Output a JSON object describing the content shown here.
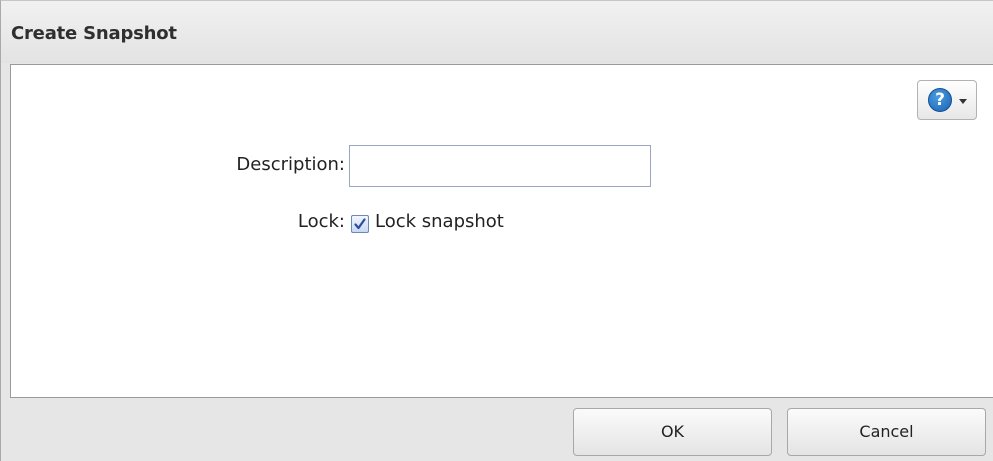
{
  "dialog": {
    "title": "Create Snapshot"
  },
  "help": {
    "icon": "help-icon",
    "glyph": "?",
    "dropdown_icon": "caret-down-icon",
    "accent_color": "#1a63b5"
  },
  "form": {
    "description_label": "Description:",
    "description_value": "",
    "lock_label": "Lock:",
    "lock_checkbox_label": "Lock snapshot",
    "lock_checked": true
  },
  "footer": {
    "ok_label": "OK",
    "cancel_label": "Cancel"
  }
}
